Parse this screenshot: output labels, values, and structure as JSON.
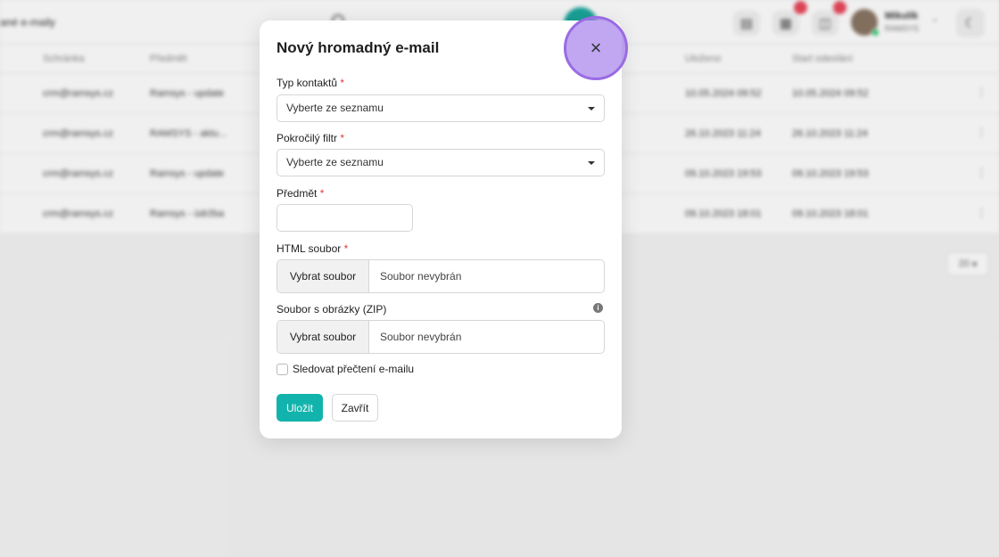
{
  "background": {
    "page_title": "ané e-maily",
    "header": {
      "user_name": "Mikulík",
      "user_sub": "RAMSYS",
      "badge_1": "",
      "badge_2": ""
    },
    "table": {
      "columns": [
        "Schránka",
        "Předmět",
        "Uloženo",
        "Start odeslání"
      ],
      "rows": [
        {
          "mailbox": "crm@ramsys.cz",
          "subject": "Ramsys - update",
          "saved": "10.05.2024 09:52",
          "start": "10.05.2024 09:52"
        },
        {
          "mailbox": "crm@ramsys.cz",
          "subject": "RAMSYS - aktu...",
          "saved": "26.10.2023 11:24",
          "start": "26.10.2023 11:24"
        },
        {
          "mailbox": "crm@ramsys.cz",
          "subject": "Ramsys - update",
          "saved": "09.10.2023 19:53",
          "start": "09.10.2023 19:53"
        },
        {
          "mailbox": "crm@ramsys.cz",
          "subject": "Ramsys - údržba",
          "saved": "09.10.2023 18:01",
          "start": "09.10.2023 18:01"
        }
      ]
    },
    "page_size": "20"
  },
  "modal": {
    "title": "Nový hromadný e-mail",
    "fields": {
      "contact_type": {
        "label": "Typ kontaktů",
        "required_mark": "*",
        "value": "Vyberte ze seznamu"
      },
      "advanced_filter": {
        "label": "Pokročilý filtr",
        "required_mark": "*",
        "value": "Vyberte ze seznamu"
      },
      "subject": {
        "label": "Předmět",
        "required_mark": "*",
        "value": ""
      },
      "html_file": {
        "label": "HTML soubor",
        "required_mark": "*",
        "button": "Vybrat soubor",
        "status": "Soubor nevybrán"
      },
      "images_zip": {
        "label": "Soubor s obrázky (ZIP)",
        "button": "Vybrat soubor",
        "status": "Soubor nevybrán"
      },
      "track_read": {
        "label": "Sledovat přečtení e-mailu",
        "checked": false
      }
    },
    "buttons": {
      "save": "Uložit",
      "close": "Zavřít"
    }
  },
  "colors": {
    "accent": "#12b3ac",
    "required": "#e03a3a",
    "highlight": "#a782ec"
  }
}
